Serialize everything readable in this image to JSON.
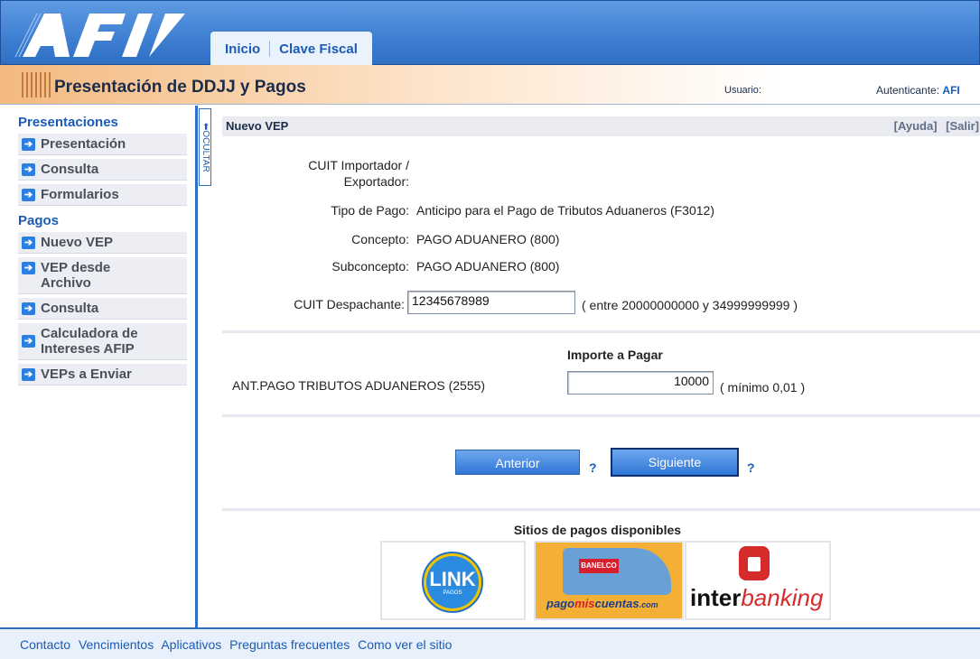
{
  "header": {
    "logo_text": "AFIP",
    "tabs": [
      {
        "label": "Inicio"
      },
      {
        "label": "Clave Fiscal"
      }
    ]
  },
  "titlebar": {
    "title": "Presentación de DDJJ y Pagos",
    "user_label": "Usuario:",
    "user_value": "",
    "auth_label": "Autenticante:",
    "auth_value": "AFI"
  },
  "sidebar": {
    "toggle_label": "OCULTAR",
    "sections": [
      {
        "heading": "Presentaciones",
        "items": [
          "Presentación",
          "Consulta",
          "Formularios"
        ]
      },
      {
        "heading": "Pagos",
        "items": [
          "Nuevo VEP",
          "VEP desde Archivo",
          "Consulta",
          "Calculadora de Intereses AFIP",
          "VEPs a Enviar"
        ]
      }
    ]
  },
  "panel": {
    "title": "Nuevo VEP",
    "help_label": "[Ayuda]",
    "exit_label": "[Salir]"
  },
  "form": {
    "cuit_importador_label": "CUIT Importador / Exportador:",
    "tipo_pago_label": "Tipo de Pago:",
    "tipo_pago_value": "Anticipo para el Pago de Tributos Aduaneros (F3012)",
    "concepto_label": "Concepto:",
    "concepto_value": "PAGO ADUANERO (800)",
    "subconcepto_label": "Subconcepto:",
    "subconcepto_value": "PAGO ADUANERO (800)",
    "cuit_despachante_label": "CUIT Despachante:",
    "cuit_despachante_value": "12345678989",
    "cuit_despachante_hint": "( entre 20000000000 y 34999999999 )",
    "importe_heading": "Importe a Pagar",
    "importe_concept": "ANT.PAGO TRIBUTOS ADUANEROS (2555)",
    "importe_value": "10000",
    "importe_hint": "( mínimo 0,01 )"
  },
  "actions": {
    "back_label": "Anterior",
    "next_label": "Siguiente",
    "help_mark": "?"
  },
  "payment_sites": {
    "title": "Sitios de pagos disponibles",
    "link_text": "LINK",
    "link_sub": "PAGOS",
    "banelco_badge": "BANELCO",
    "pmc_text_a": "pago",
    "pmc_text_b": "mis",
    "pmc_text_c": "cuentas",
    "pmc_text_d": ".com",
    "interbanking_a": "inter",
    "interbanking_b": "banking"
  },
  "footer": {
    "links": [
      "Contacto",
      "Vencimientos",
      "Aplicativos",
      "Preguntas frecuentes",
      "Como ver el sitio"
    ]
  },
  "colors": {
    "accent": "#1a5bb5",
    "banner": "#3e7fd2",
    "title_gradient": "#f3b97f"
  }
}
